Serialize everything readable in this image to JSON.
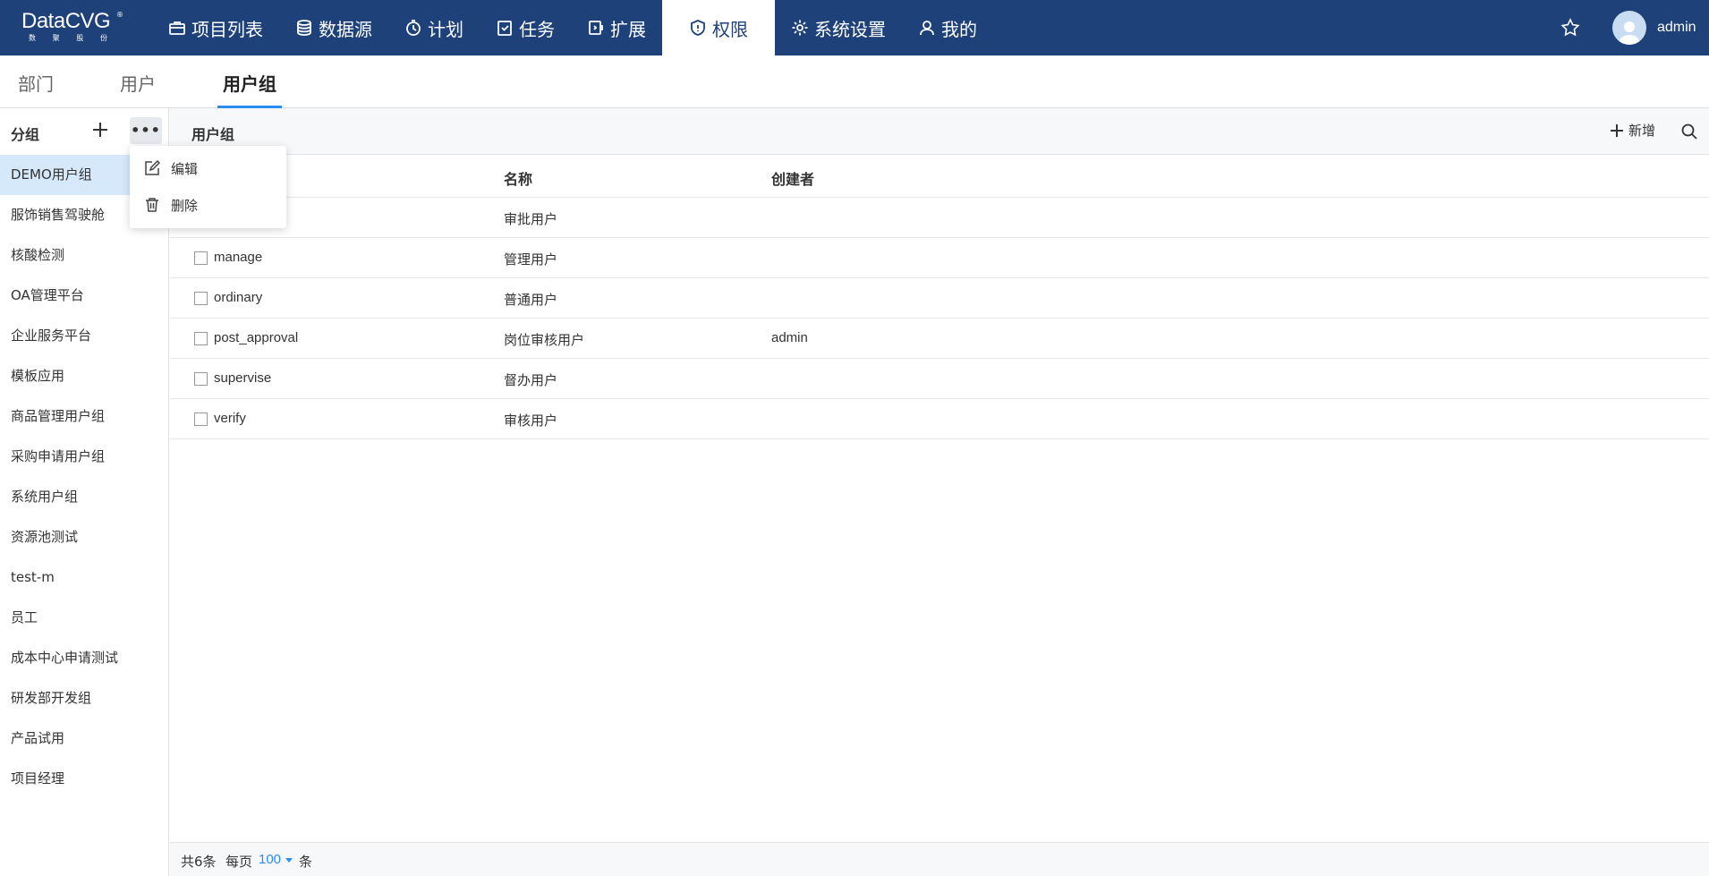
{
  "app": {
    "logo_text": "DataCVG",
    "logo_reg": "®",
    "logo_sub": [
      "数",
      "聚",
      "股",
      "份"
    ]
  },
  "nav": {
    "items": [
      {
        "label": "项目列表",
        "icon": "briefcase-icon"
      },
      {
        "label": "数据源",
        "icon": "database-icon"
      },
      {
        "label": "计划",
        "icon": "timer-icon"
      },
      {
        "label": "任务",
        "icon": "clipboard-check-icon"
      },
      {
        "label": "扩展",
        "icon": "extension-icon"
      },
      {
        "label": "权限",
        "icon": "shield-icon",
        "active": true
      },
      {
        "label": "系统设置",
        "icon": "gear-icon"
      },
      {
        "label": "我的",
        "icon": "user-icon"
      }
    ],
    "username": "admin"
  },
  "subtabs": {
    "items": [
      "部门",
      "用户",
      "用户组"
    ],
    "active": "用户组"
  },
  "sidebar": {
    "title": "分组",
    "groups": [
      "DEMO用户组",
      "服饰销售驾驶舱",
      "核酸检测",
      "OA管理平台",
      "企业服务平台",
      "模板应用",
      "商品管理用户组",
      "采购申请用户组",
      "系统用户组",
      "资源池测试",
      "test-m",
      "员工",
      "成本中心申请测试",
      "研发部开发组",
      "产品试用",
      "项目经理"
    ],
    "selected": "DEMO用户组"
  },
  "dropdown": {
    "edit": "编辑",
    "delete": "删除"
  },
  "main": {
    "title": "用户组",
    "add_label": "新增"
  },
  "table": {
    "columns": [
      "名称",
      "创建者"
    ],
    "rows": [
      {
        "code": "",
        "name": "审批用户",
        "creator": ""
      },
      {
        "code": "manage",
        "name": "管理用户",
        "creator": ""
      },
      {
        "code": "ordinary",
        "name": "普通用户",
        "creator": ""
      },
      {
        "code": "post_approval",
        "name": "岗位审核用户",
        "creator": "admin"
      },
      {
        "code": "supervise",
        "name": "督办用户",
        "creator": ""
      },
      {
        "code": "verify",
        "name": "审核用户",
        "creator": ""
      }
    ]
  },
  "footer": {
    "total": "共6条",
    "per_page_label": "每页",
    "page_size": "100",
    "unit": "条"
  }
}
